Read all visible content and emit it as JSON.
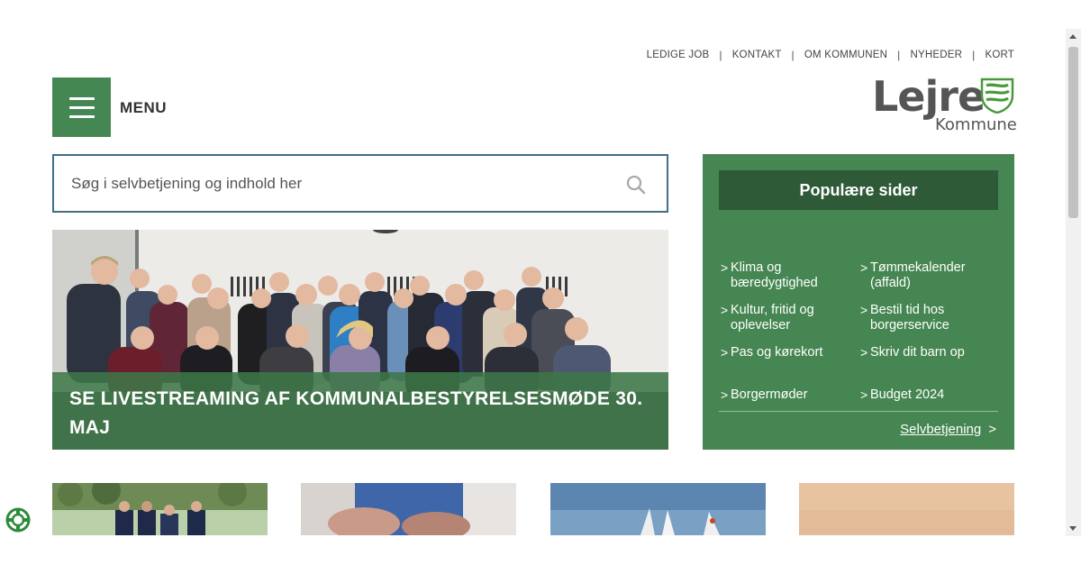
{
  "topnav": {
    "items": [
      "LEDIGE JOB",
      "KONTAKT",
      "OM KOMMUNEN",
      "NYHEDER",
      "KORT"
    ],
    "separator": "|"
  },
  "menu": {
    "label": "MENU"
  },
  "logo": {
    "name": "Lejre",
    "subtitle": "Kommune",
    "icon": "shield-icon"
  },
  "search": {
    "placeholder": "Søg i selvbetjening og indhold her",
    "icon": "search-icon"
  },
  "hero": {
    "caption": "SE LIVESTREAMING AF KOMMUNALBESTYRELSESMØDE 30. MAJ"
  },
  "popular": {
    "title": "Populære sider",
    "links": [
      [
        "Klima og",
        "bæredygtighed"
      ],
      [
        "Tømmekalender",
        "(affald)"
      ],
      [
        "Kultur, fritid og",
        "oplevelser"
      ],
      [
        "Bestil tid hos",
        "borgerservice"
      ],
      [
        "Pas og kørekort"
      ],
      [
        "Skriv dit barn op"
      ],
      [
        "Borgermøder"
      ],
      [
        "Budget 2024"
      ]
    ],
    "chevron": ">",
    "footer_link": "Selvbetjening",
    "footer_chevron": ">"
  },
  "colors": {
    "brand_green": "#458752",
    "dark_green": "#2e5a38",
    "search_border": "#3f6f8c",
    "text_gray": "#555555"
  }
}
